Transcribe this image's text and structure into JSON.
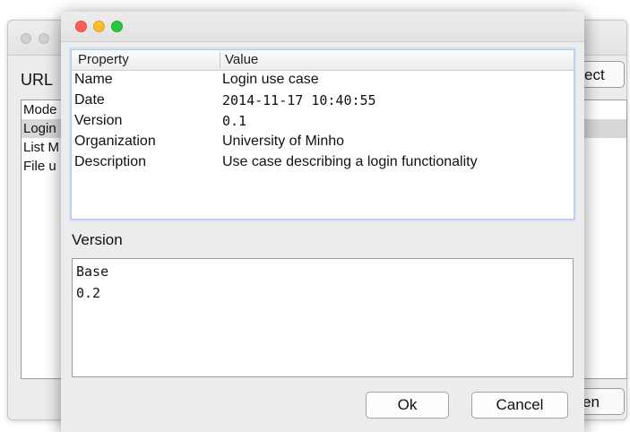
{
  "background_window": {
    "url_label": "URL",
    "connect_label": "ect",
    "open_label": "en",
    "list_items": [
      "Mode",
      "Login",
      "List M",
      "File u"
    ],
    "selected_index": 1
  },
  "dialog": {
    "table": {
      "headers": {
        "property": "Property",
        "value": "Value"
      },
      "rows": [
        {
          "property": "Name",
          "value": "Login use case"
        },
        {
          "property": "Date",
          "value": "2014-11-17 10:40:55"
        },
        {
          "property": "Version",
          "value": "0.1"
        },
        {
          "property": "Organization",
          "value": "University of Minho"
        },
        {
          "property": "Description",
          "value": "Use case describing a login functionality"
        }
      ]
    },
    "version_label": "Version",
    "version_items": [
      "Base",
      "0.2"
    ],
    "buttons": {
      "ok": "Ok",
      "cancel": "Cancel"
    }
  },
  "colors": {
    "close": "#fc5f57",
    "minimize": "#fdbd2e",
    "maximize": "#28c840",
    "selection": "#d7d7d7",
    "focus_ring": "#cfe0f6"
  }
}
